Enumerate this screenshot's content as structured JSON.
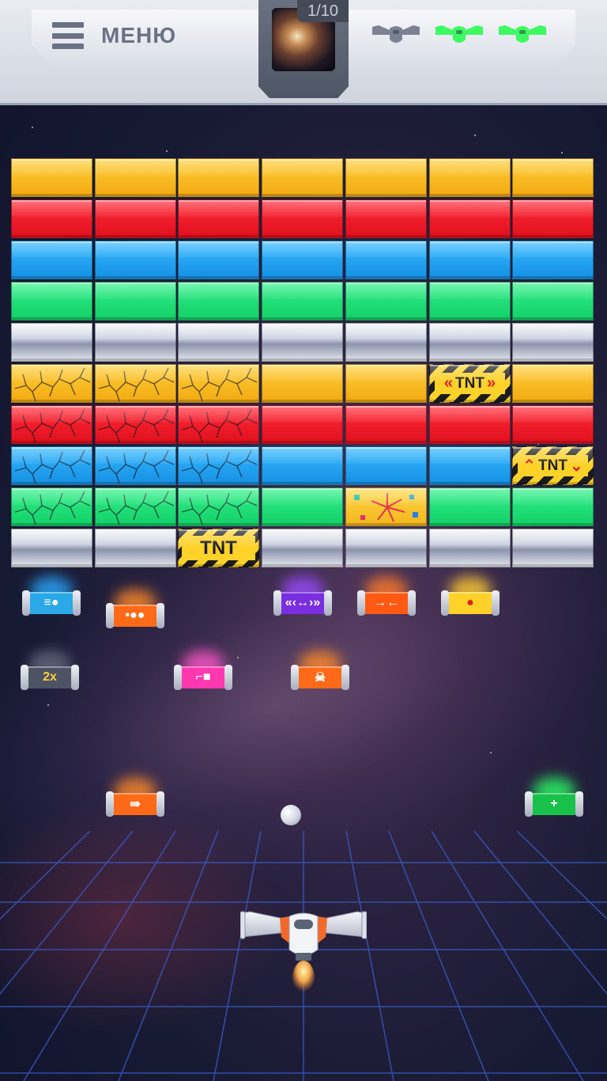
{
  "header": {
    "menu_label": "МЕНЮ",
    "level": "1/10",
    "lives": [
      {
        "icon": "ship-life-icon",
        "active": false,
        "color": "#7c8294"
      },
      {
        "icon": "ship-life-icon",
        "active": true,
        "color": "#3dfa63"
      },
      {
        "icon": "ship-life-icon",
        "active": true,
        "color": "#3dfa63"
      }
    ]
  },
  "bricks": {
    "columns": 7,
    "rows": [
      [
        "yellow",
        "yellow",
        "yellow",
        "yellow",
        "yellow",
        "yellow",
        "yellow"
      ],
      [
        "red",
        "red",
        "red",
        "red",
        "red",
        "red",
        "red"
      ],
      [
        "blue",
        "blue",
        "blue",
        "blue",
        "blue",
        "blue",
        "blue"
      ],
      [
        "green",
        "green",
        "green",
        "green",
        "green",
        "green",
        "green"
      ],
      [
        "metal",
        "metal",
        "metal",
        "metal",
        "metal",
        "metal",
        "metal"
      ],
      [
        "yellow-cracked",
        "yellow-cracked",
        "yellow-cracked",
        "yellow",
        "yellow",
        "tnt-horizontal",
        "yellow"
      ],
      [
        "red-cracked",
        "red-cracked",
        "red-cracked",
        "red",
        "red",
        "red",
        "red"
      ],
      [
        "blue-cracked",
        "blue-cracked",
        "blue-cracked",
        "blue",
        "blue",
        "blue",
        "tnt-vertical"
      ],
      [
        "green-cracked",
        "green-cracked",
        "green-cracked",
        "green",
        "confetti",
        "green",
        "green"
      ],
      [
        "metal",
        "metal",
        "tnt",
        "metal",
        "metal",
        "metal",
        "metal"
      ]
    ],
    "tnt_label": "TNT"
  },
  "powerups": [
    {
      "icon": "fast-ball-icon",
      "color": "#2aa8e8",
      "glow": "#2aa8ff",
      "symbol": "≡●"
    },
    {
      "icon": "multi-ball-icon",
      "color": "#ff6a18",
      "glow": "#ff8a2a",
      "symbol": "•●●"
    },
    {
      "icon": "expand-paddle-icon",
      "color": "#7a2ee0",
      "glow": "#9a4aff",
      "symbol": "«‹↔›»"
    },
    {
      "icon": "shrink-paddle-icon",
      "color": "#ff5a14",
      "glow": "#ff7a2a",
      "symbol": "→←"
    },
    {
      "icon": "fire-ball-icon",
      "color": "#ffd22a",
      "glow": "#ffcc33",
      "symbol": "●"
    },
    {
      "icon": "double-score-icon",
      "color": "#4d5264",
      "glow": "#666a80",
      "symbol": "2x"
    },
    {
      "icon": "laser-gun-icon",
      "color": "#ff38b0",
      "glow": "#ff55c8",
      "symbol": "⌐■"
    },
    {
      "icon": "skull-icon",
      "color": "#ff6a18",
      "glow": "#ff8a2a",
      "symbol": "☠"
    },
    {
      "icon": "rocket-icon",
      "color": "#ff6a18",
      "glow": "#ff8a2a",
      "symbol": "⇛"
    },
    {
      "icon": "extra-life-icon",
      "color": "#18c24a",
      "glow": "#2aff66",
      "symbol": "+"
    }
  ]
}
